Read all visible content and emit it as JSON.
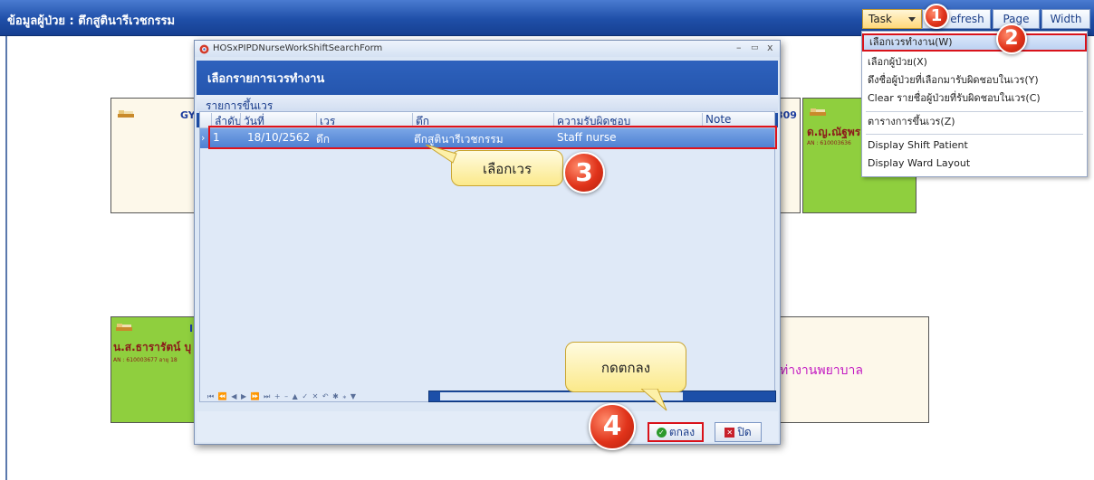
{
  "app": {
    "title": "ข้อมูลผู้ป่วย : ตึกสูตินารีเวชกรรม",
    "toolbar": {
      "task_label": "Task",
      "refresh_label": "efresh",
      "page_label": "Page",
      "width_label": "Width"
    }
  },
  "cards": {
    "top_left_partial": "GY",
    "top_right_partial": "309",
    "top_right_name": "ด.ญ.ณัฐพร",
    "top_right_an": "AN : 610003636",
    "bottom_left_name": "น.ส.ธารารัตน์ บุ",
    "bottom_left_partial": "I",
    "bottom_left_an": "AN : 610003677   อายุ 18",
    "bottom_right_text": "ท่างานพยาบาล"
  },
  "dialog": {
    "window_title": "HOSxPIPDNurseWorkShiftSearchForm",
    "controls": {
      "minimize": "–",
      "maximize": "▭",
      "close": "x"
    },
    "header": "เลือกรายการเวรทำงาน",
    "section": "รายการขึ้นเวร",
    "columns": [
      "ลำดับ",
      "วันที่",
      "เวร",
      "ตึก",
      "ความรับผิดชอบ",
      "Note"
    ],
    "rows": [
      {
        "no": "1",
        "date": "18/10/2562",
        "shift": "ดึก",
        "ward": "ตึกสูตินารีเวชกรรม",
        "duty": "Staff nurse",
        "note": ""
      }
    ],
    "nav_strip": "⏮ ⏪ ◀ ▶ ⏩ ⏭ + – ▲ ✓ ✕ ↶ ✱ ⁎ ▼",
    "ok_label": "ตกลง",
    "close_label": "ปิด"
  },
  "menu": {
    "items": [
      {
        "label": "เลือกเวรทำงาน(W)"
      },
      {
        "label": "เลือกผู้ป่วย(X)"
      },
      {
        "label": "ดึงชื่อผู้ป่วยที่เลือกมารับผิดชอบในเวร(Y)"
      },
      {
        "label": "Clear รายชื่อผู้ป่วยที่รับผิดชอบในเวร(C)"
      },
      {
        "label": "ตารางการขึ้นเวร(Z)"
      },
      {
        "label": "Display Shift Patient"
      },
      {
        "label": "Display Ward Layout"
      }
    ]
  },
  "annotations": {
    "badges": [
      "1",
      "2",
      "3",
      "4"
    ],
    "callout_select_shift": "เลือกเวร",
    "callout_press_ok": "กดตกลง"
  },
  "colors": {
    "titlebar": "#1f4fa8",
    "highlight_red": "#e0121a",
    "card_green": "#8fcf3e",
    "card_beige": "#fdf8ea",
    "row_selected": "#4d7fd2"
  }
}
